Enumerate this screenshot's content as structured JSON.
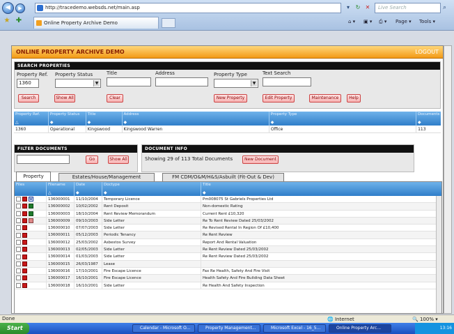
{
  "browser": {
    "url": "http://tracedemo.websds.net/main.asp",
    "search_placeholder": "Live Search",
    "tab_title": "Online Property Archive Demo",
    "page_menu": "Page",
    "tools_menu": "Tools"
  },
  "app": {
    "title": "ONLINE PROPERTY ARCHIVE DEMO",
    "logout": "LOGOUT"
  },
  "search": {
    "section_title": "SEARCH PROPERTIES",
    "labels": {
      "property_ref": "Property Ref.",
      "property_status": "Property Status",
      "title": "Title",
      "address": "Address",
      "property_type": "Property Type",
      "text_search": "Text Search"
    },
    "property_ref_value": "1360",
    "buttons": {
      "search": "Search",
      "show_all": "Show All",
      "clear": "Clear",
      "new_property": "New Property",
      "edit_property": "Edit Property",
      "maintenance": "Maintenance",
      "help": "Help"
    }
  },
  "property_table": {
    "headers": [
      "Property Ref.",
      "Property Status",
      "Title",
      "Address",
      "Property Type",
      "Documents"
    ],
    "row": [
      "1360",
      "Operational",
      "Kingswood",
      "Kingswood Warren",
      "Office",
      "113"
    ]
  },
  "filter": {
    "section_title": "FILTER DOCUMENTS",
    "go": "Go",
    "show_all": "Show All"
  },
  "doc_info": {
    "section_title": "DOCUMENT INFO",
    "summary": "Showing 29 of 113 Total Documents",
    "new_document": "New Document"
  },
  "tabs": [
    "Property",
    "Estates/House/Management",
    "FM CDM/O&M/H&S/Asbuilt (Fit-Out & Dev)"
  ],
  "doc_table": {
    "headers": [
      "Files",
      "Filename",
      "Date",
      "Doctype",
      "Title"
    ],
    "rows": [
      {
        "files": [
          "blank",
          "pdf",
          "word"
        ],
        "filename": "136000001",
        "date": "11/10/2004",
        "doctype": "Temporary Licence",
        "title": "Pm008075 St Gabriels Properties Ltd"
      },
      {
        "files": [
          "blank",
          "pdf",
          "xls"
        ],
        "filename": "136000002",
        "date": "10/02/2002",
        "doctype": "Rent Deposit",
        "title": "Non-domestic Rating"
      },
      {
        "files": [
          "blank",
          "pdf",
          "xls"
        ],
        "filename": "136000003",
        "date": "18/10/2004",
        "doctype": "Rent Review Memorandum",
        "title": "Current Rent £10,320"
      },
      {
        "files": [
          "blank",
          "pdf",
          "ppt"
        ],
        "filename": "136000009",
        "date": "09/10/2003",
        "doctype": "Side Letter",
        "title": "Re To Rent Review Dated 25/03/2002"
      },
      {
        "files": [
          "blank",
          "pdf"
        ],
        "filename": "136000010",
        "date": "07/07/2003",
        "doctype": "Side Letter",
        "title": "Re Revised Rental In Region Of £10,400"
      },
      {
        "files": [
          "blank",
          "pdf"
        ],
        "filename": "136000011",
        "date": "05/12/2003",
        "doctype": "Periodic Tenancy",
        "title": "Re Rent Review"
      },
      {
        "files": [
          "blank",
          "pdf"
        ],
        "filename": "136000012",
        "date": "25/03/2002",
        "doctype": "Asbestos Survey",
        "title": "Report And Rental Valuation"
      },
      {
        "files": [
          "blank",
          "pdf"
        ],
        "filename": "136000013",
        "date": "02/05/2003",
        "doctype": "Side Letter",
        "title": "Re Rent Review Dated 25/03/2002"
      },
      {
        "files": [
          "blank",
          "pdf"
        ],
        "filename": "136000014",
        "date": "01/03/2003",
        "doctype": "Side Letter",
        "title": "Re Rent Review Dated 25/03/2002"
      },
      {
        "files": [
          "blank",
          "pdf"
        ],
        "filename": "136000015",
        "date": "26/03/1987",
        "doctype": "Lease",
        "title": ""
      },
      {
        "files": [
          "blank",
          "pdf"
        ],
        "filename": "136000016",
        "date": "17/10/2001",
        "doctype": "Fire Escape Licence",
        "title": "Fax Re Health, Safety And Fire Visit"
      },
      {
        "files": [
          "blank",
          "pdf"
        ],
        "filename": "136000017",
        "date": "16/10/2001",
        "doctype": "Fire Escape Licence",
        "title": "Health Safety And Fire Building Data Sheet"
      },
      {
        "files": [
          "blank",
          "pdf"
        ],
        "filename": "136000018",
        "date": "16/10/2001",
        "doctype": "Side Letter",
        "title": "Re Health And Safety Inspection"
      }
    ]
  },
  "status": {
    "left": "Done",
    "zone": "Internet",
    "zoom": "100%"
  },
  "taskbar": {
    "start": "Start",
    "tasks": [
      "Calendar - Microsoft O...",
      "Property Management...",
      "Microsoft Excel - 16_5...",
      "Online Property Arc..."
    ],
    "clock": "13:16"
  }
}
